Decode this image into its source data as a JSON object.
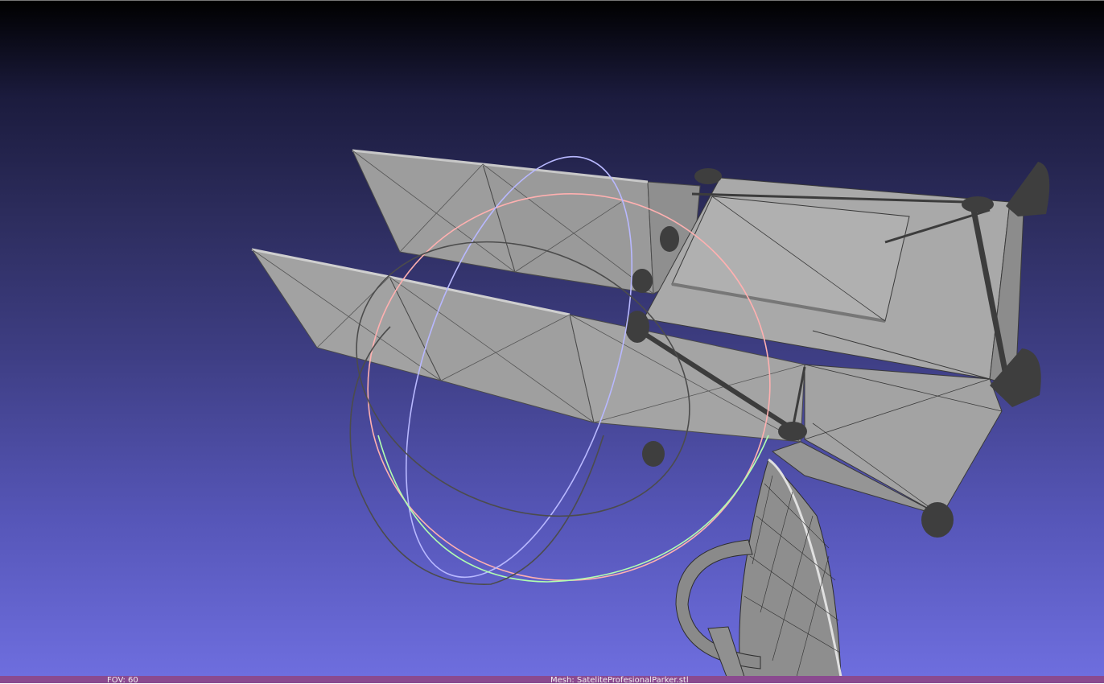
{
  "viewer": {
    "background_top_color": "#000000",
    "background_bottom_color": "#7070e0",
    "mesh_color": "#a6a6a6",
    "edge_color": "#3c3c3c",
    "trackball_colors": {
      "x": "#ff9a9a",
      "y": "#9aff9a",
      "z": "#9a9aff",
      "neutral": "#555555"
    }
  },
  "status": {
    "fov_label": "FOV: 60",
    "mesh_label": "Mesh: SateliteProfesionalParker.stl"
  }
}
